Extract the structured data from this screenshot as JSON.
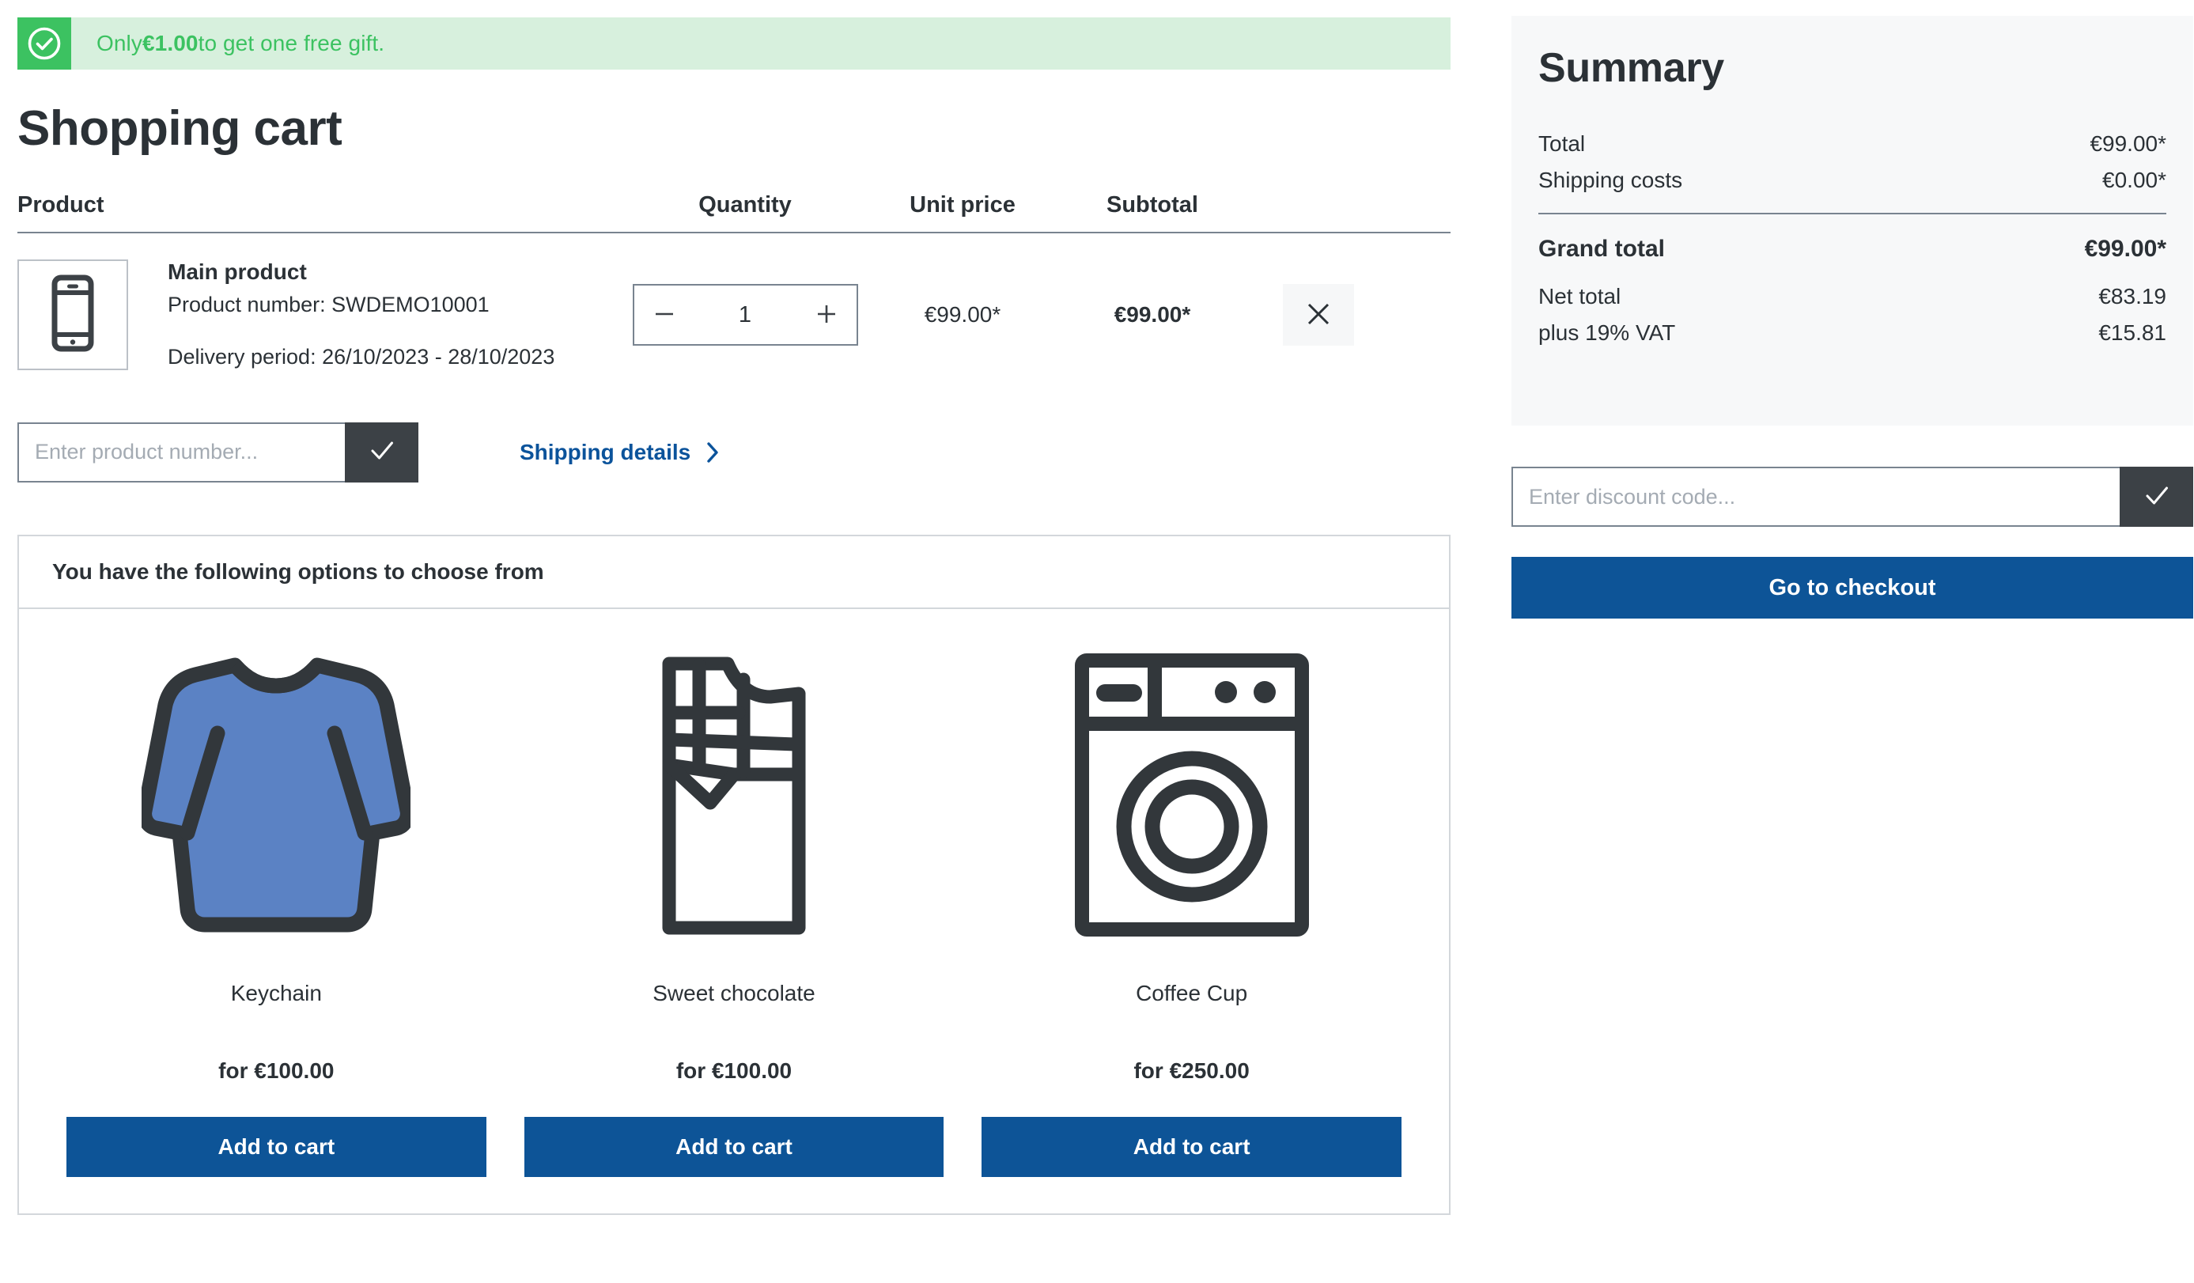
{
  "alert": {
    "icon": "check-circle-icon",
    "prefix": "Only ",
    "amount": "€1.00",
    "suffix": " to get one free gift.",
    "bg_color": "#d7f0dd",
    "accent_color": "#3cc261"
  },
  "page": {
    "title": "Shopping cart"
  },
  "cart": {
    "columns": {
      "product": "Product",
      "quantity": "Quantity",
      "unit_price": "Unit price",
      "subtotal": "Subtotal"
    },
    "items": [
      {
        "thumb_icon": "smartphone-icon",
        "name": "Main product",
        "product_number": "Product number: SWDEMO10001",
        "delivery_period": "Delivery period: 26/10/2023 - 28/10/2023",
        "quantity": "1",
        "decrement_label": "−",
        "increment_label": "+",
        "unit_price": "€99.00*",
        "subtotal": "€99.00*",
        "remove_icon": "close-icon"
      }
    ]
  },
  "product_number_form": {
    "placeholder": "Enter product number...",
    "value": "",
    "submit_icon": "check-icon"
  },
  "shipping_details": {
    "label": "Shipping details",
    "chevron_icon": "chevron-right-icon"
  },
  "gift_panel": {
    "heading": "You have the following options to choose from",
    "options": [
      {
        "icon": "sweater-icon",
        "name": "Keychain",
        "price": "for €100.00",
        "button_label": "Add to cart"
      },
      {
        "icon": "chocolate-bar-icon",
        "name": "Sweet chocolate",
        "price": "for €100.00",
        "button_label": "Add to cart"
      },
      {
        "icon": "washing-machine-icon",
        "name": "Coffee Cup",
        "price": "for €250.00",
        "button_label": "Add to cart"
      }
    ]
  },
  "summary": {
    "title": "Summary",
    "total_label": "Total",
    "total_value": "€99.00*",
    "shipping_label": "Shipping costs",
    "shipping_value": "€0.00*",
    "grand_total_label": "Grand total",
    "grand_total_value": "€99.00*",
    "net_total_label": "Net total",
    "net_total_value": "€83.19",
    "vat_label": "plus 19% VAT",
    "vat_value": "€15.81"
  },
  "discount_form": {
    "placeholder": "Enter discount code...",
    "value": "",
    "submit_icon": "check-icon"
  },
  "checkout": {
    "label": "Go to checkout",
    "color": "#0d5497"
  },
  "colors": {
    "primary_blue": "#0d5497",
    "link_blue": "#0b539b",
    "dark_gray": "#3c4146",
    "text": "#2b3136",
    "border": "#798490",
    "panel_border": "#d3d7db",
    "summary_bg": "#f7f8f9",
    "success_green": "#3cc261",
    "sweater_blue": "#5b82c4"
  }
}
